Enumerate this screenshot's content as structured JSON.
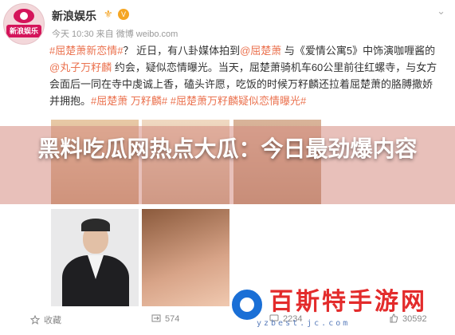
{
  "post": {
    "account_name": "新浪娱乐",
    "avatar_text": "新浪娱乐",
    "meta": "今天 10:30 来自 微博 weibo.com",
    "content_parts": [
      "#屈楚萧新恋情#",
      "？ 近日，有八卦媒体拍到",
      "@屈楚萧",
      " 与《爱情公寓5》中饰演咖喱酱的",
      "@丸子万籽麟",
      " 约会，疑似恋情曝光。当天，屈楚萧骑机车60公里前往红螺寺，与女方会面后一同在寺中虔诚上香，磕头许愿，吃饭的时候万籽麟还拉着屈楚萧的胳膊撒娇并拥抱。",
      "#屈楚萧 万籽麟#",
      " ",
      "#屈楚萧万籽麟疑似恋情曝光#"
    ]
  },
  "banner": {
    "text": "黑料吃瓜网热点大瓜：今日最劲爆内容"
  },
  "footer": {
    "share": "收藏",
    "repost": "574",
    "comments": "2234",
    "likes": "30592"
  },
  "watermark": {
    "text": "百斯特手游网",
    "url": "yzbest.jc.com"
  },
  "colors": {
    "link": "#eb7350",
    "banner_overlay": "#d68c82",
    "watermark_red": "#e32b2b",
    "watermark_blue": "#1a6fd6"
  }
}
